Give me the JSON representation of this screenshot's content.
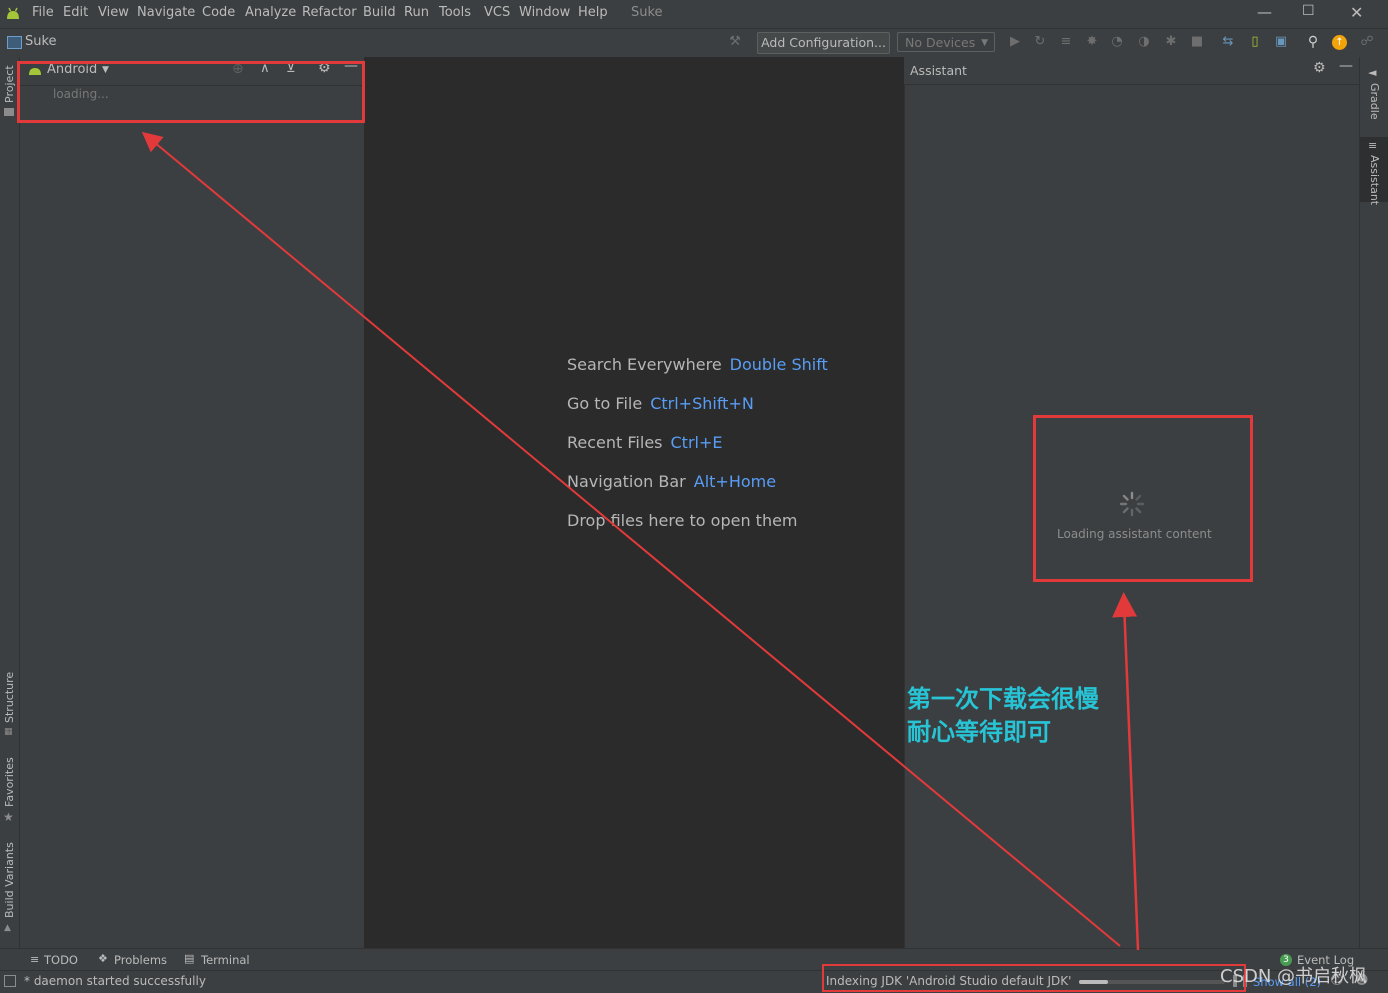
{
  "menubar": {
    "items": [
      "File",
      "Edit",
      "View",
      "Navigate",
      "Code",
      "Analyze",
      "Refactor",
      "Build",
      "Run",
      "Tools",
      "VCS",
      "Window",
      "Help"
    ],
    "project_title": "Suke"
  },
  "navbar": {
    "project_name": "Suke",
    "add_configuration": "Add Configuration...",
    "devices": "No Devices"
  },
  "left_stripe": {
    "project": "Project",
    "structure": "Structure",
    "favorites": "Favorites",
    "build_variants": "Build Variants"
  },
  "project_panel": {
    "view_selector": "Android",
    "loading_text": "loading..."
  },
  "editor": {
    "hints": [
      {
        "label": "Search Everywhere",
        "key": "Double Shift"
      },
      {
        "label": "Go to File",
        "key": "Ctrl+Shift+N"
      },
      {
        "label": "Recent Files",
        "key": "Ctrl+E"
      },
      {
        "label": "Navigation Bar",
        "key": "Alt+Home"
      }
    ],
    "drop_text": "Drop files here to open them"
  },
  "assistant": {
    "title": "Assistant",
    "loading_text": "Loading assistant content"
  },
  "right_stripe": {
    "gradle": "Gradle",
    "assistant": "Assistant"
  },
  "bottom_tabs": {
    "todo": "TODO",
    "problems": "Problems",
    "terminal": "Terminal",
    "event_log": "Event Log",
    "event_count": "3"
  },
  "statusbar": {
    "message": "* daemon started successfully",
    "indexing": "Indexing JDK 'Android Studio default JDK'",
    "indexing_progress": 0.2,
    "show_all": "Show all (2)"
  },
  "annotation": {
    "line1": "第一次下载会很慢",
    "line2": "耐心等待即可"
  },
  "watermark": "CSDN @书启秋枫",
  "colors": {
    "annotation_red": "#e23a3a",
    "annotation_cyan": "#27c4d6",
    "shortcut_blue": "#589df6",
    "android_green": "#a4c639"
  }
}
